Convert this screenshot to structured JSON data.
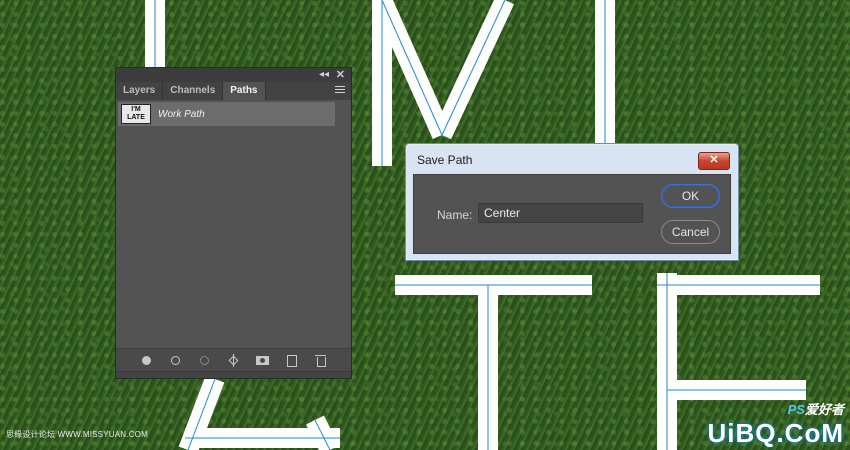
{
  "panel": {
    "tabs": [
      {
        "label": "Layers",
        "active": false
      },
      {
        "label": "Channels",
        "active": false
      },
      {
        "label": "Paths",
        "active": true
      }
    ],
    "paths": [
      {
        "name": "Work Path",
        "thumbnail_text": "I'M LATE"
      }
    ],
    "footer_icons": [
      "fill-path-icon",
      "stroke-path-icon",
      "load-selection-icon",
      "make-work-path-icon",
      "add-mask-icon",
      "new-path-icon",
      "delete-path-icon"
    ]
  },
  "dialog": {
    "title": "Save Path",
    "name_label": "Name:",
    "name_value": "Center",
    "ok_label": "OK",
    "cancel_label": "Cancel"
  },
  "watermarks": {
    "left": "思缘设计论坛 WWW.MISSYUAN.COM",
    "right_top_ps": "PS",
    "right_top_rest": "爱好者",
    "right_site": "UiBQ.CoM"
  },
  "colors": {
    "grass": "#335f22",
    "letter_stroke": "#ffffff",
    "guide_path": "#1e88d6",
    "panel_bg": "#535353",
    "ok_focus": "#3f6fd3",
    "close_red": "#c9452f"
  }
}
